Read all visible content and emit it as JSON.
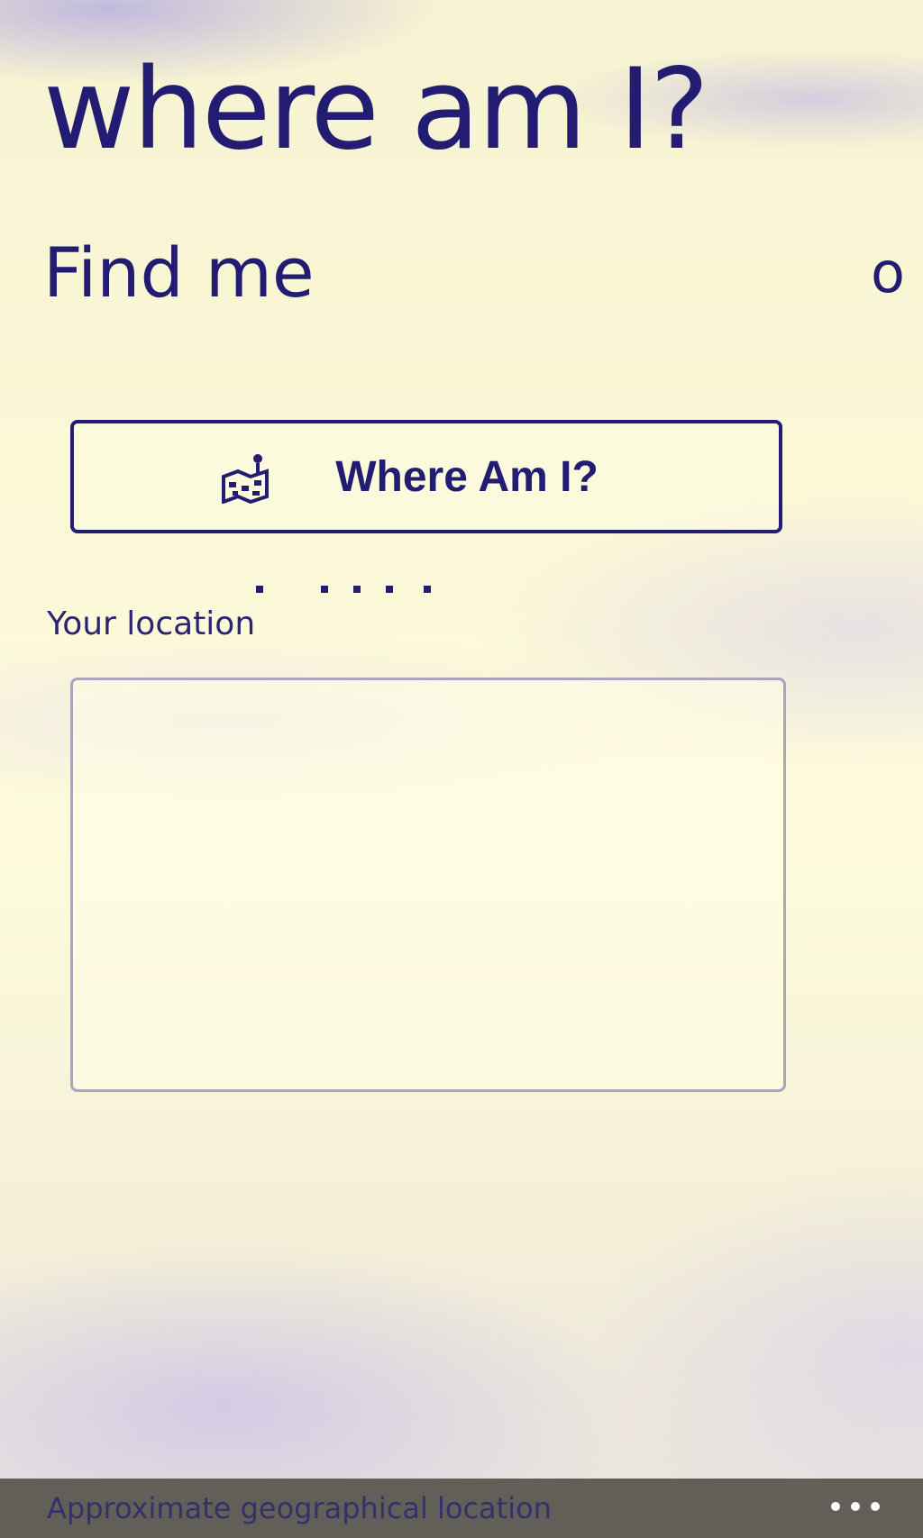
{
  "app": {
    "title": "where am I?"
  },
  "pivot": {
    "current": "Find me",
    "next_peek": "o"
  },
  "find_button": {
    "icon": "map-location-icon",
    "label": "Where Am I?"
  },
  "location": {
    "label": "Your location",
    "value": ""
  },
  "app_bar": {
    "status_text": "Approximate geographical location",
    "more_icon": "ellipsis-icon"
  },
  "colors": {
    "accent": "#221c72",
    "background": "#fbf8d6",
    "app_bar": "#615f58"
  }
}
